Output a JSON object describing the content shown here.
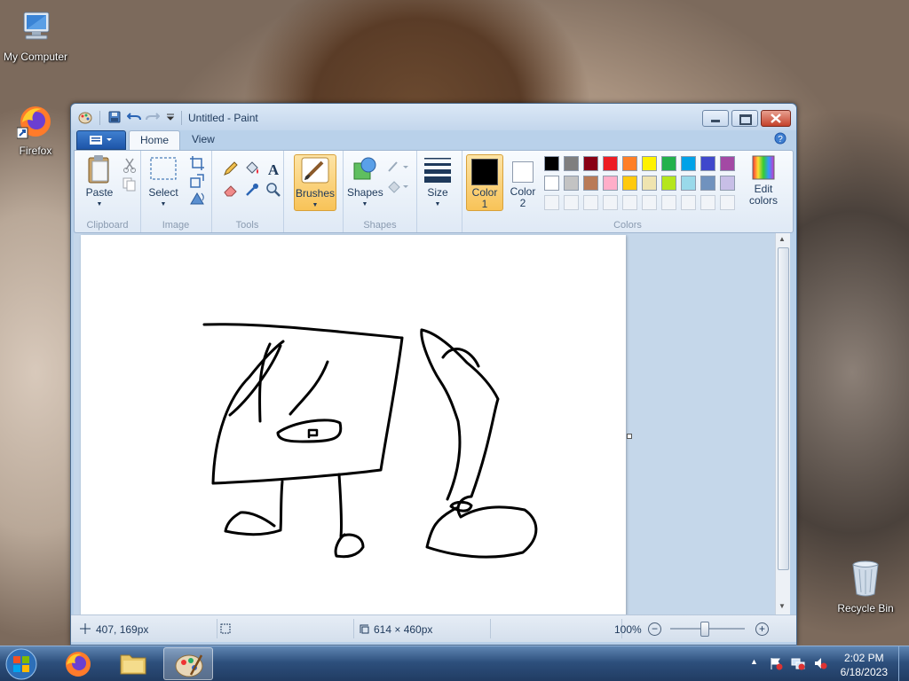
{
  "desktop": {
    "icons": [
      {
        "label": "My Computer",
        "icon": "computer-icon"
      },
      {
        "label": "Firefox",
        "icon": "firefox-icon"
      },
      {
        "label": "Recycle Bin",
        "icon": "recycle-bin-icon"
      }
    ]
  },
  "window": {
    "title": "Untitled - Paint",
    "tabs": [
      {
        "label": "Home",
        "active": true
      },
      {
        "label": "View",
        "active": false
      }
    ],
    "ribbon": {
      "groups": {
        "clipboard": "Clipboard",
        "image": "Image",
        "tools": "Tools",
        "shapes": "Shapes",
        "colors": "Colors"
      },
      "paste": "Paste",
      "select": "Select",
      "brushes": "Brushes",
      "shapes_btn": "Shapes",
      "size": "Size",
      "color1": {
        "line1": "Color",
        "line2": "1",
        "value": "#000000"
      },
      "color2": {
        "line1": "Color",
        "line2": "2",
        "value": "#ffffff"
      },
      "edit_colors": {
        "line1": "Edit",
        "line2": "colors"
      },
      "palette_row1": [
        "#000000",
        "#7f7f7f",
        "#880015",
        "#ed1c24",
        "#ff7f27",
        "#fff200",
        "#22b14c",
        "#00a2e8",
        "#3f48cc",
        "#a349a4"
      ],
      "palette_row2": [
        "#ffffff",
        "#c3c3c3",
        "#b97a57",
        "#ffaec9",
        "#ffc90e",
        "#efe4b0",
        "#b5e61d",
        "#99d9ea",
        "#7092be",
        "#c8bfe7"
      ]
    },
    "status": {
      "cursor_pos": "407, 169px",
      "selection_size": "",
      "image_size": "614 × 460px",
      "zoom": "100%",
      "zoom_level": 1.0
    }
  },
  "taskbar": {
    "time": "2:02 PM",
    "date": "6/18/2023"
  }
}
